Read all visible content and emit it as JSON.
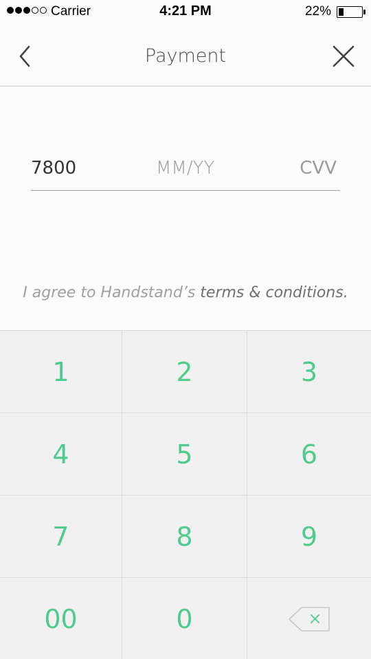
{
  "status_bar": {
    "carrier": "Carrier",
    "time": "4:21 PM",
    "battery_percent": "22%",
    "battery_level": 0.22,
    "signal_bars_filled": 3,
    "signal_bars_total": 5
  },
  "navbar": {
    "title": "Payment",
    "back_icon": "chevron-left-icon",
    "close_icon": "close-icon"
  },
  "card_form": {
    "card_number_value": "7800",
    "expiry_placeholder": "MM/YY",
    "cvv_placeholder": "CVV"
  },
  "terms": {
    "prefix": "I agree to Handstand’s ",
    "link": "terms & conditions."
  },
  "keypad": {
    "keys": [
      "1",
      "2",
      "3",
      "4",
      "5",
      "6",
      "7",
      "8",
      "9",
      "00",
      "0"
    ],
    "backspace_icon": "backspace-icon"
  },
  "colors": {
    "accent": "#4ecb8d",
    "keypad_bg": "#f0f0f0",
    "text_dark": "#4a4a4a",
    "placeholder": "#9a9a9a"
  }
}
